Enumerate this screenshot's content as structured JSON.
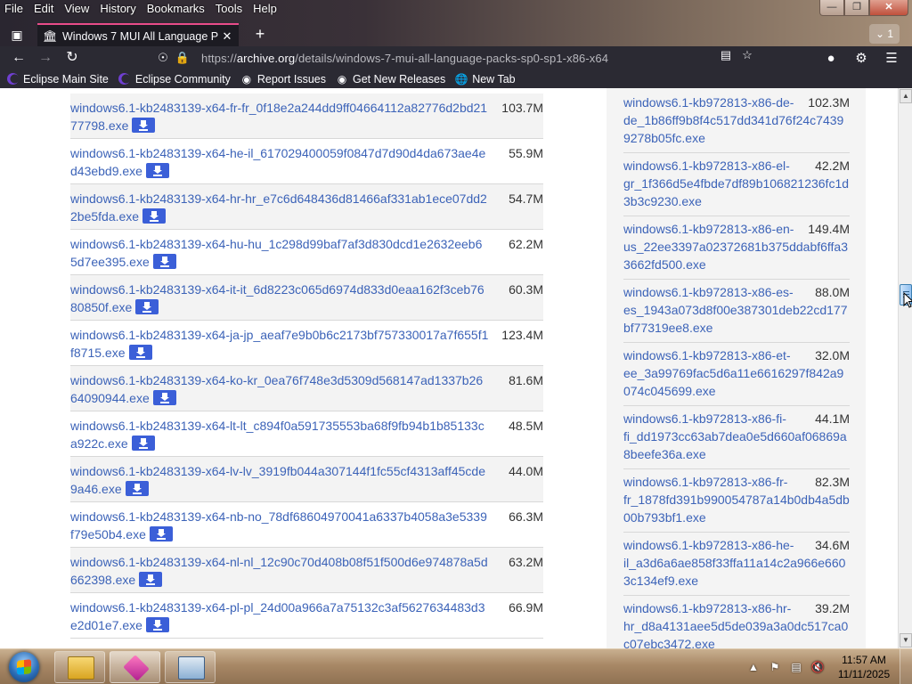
{
  "menubar": {
    "items": [
      "File",
      "Edit",
      "View",
      "History",
      "Bookmarks",
      "Tools",
      "Help"
    ]
  },
  "tabs": {
    "active_title": "Windows 7 MUI All Language P",
    "tab_count": "1"
  },
  "navbar": {
    "url_prefix": "https://",
    "url_host": "archive.org",
    "url_path": "/details/windows-7-mui-all-language-packs-sp0-sp1-x86-x64"
  },
  "bookmarks": [
    {
      "label": "Eclipse Main Site",
      "icon": "eclipse-icon"
    },
    {
      "label": "Eclipse Community",
      "icon": "eclipse-icon"
    },
    {
      "label": "Report Issues",
      "icon": "github-icon"
    },
    {
      "label": "Get New Releases",
      "icon": "github-icon"
    },
    {
      "label": "New Tab",
      "icon": "globe-icon"
    }
  ],
  "left_files": [
    {
      "name": "windows6.1-kb2483139-x64-fr-fr_0f18e2a244dd9ff04664112a82776d2bd2177798.exe",
      "size": "103.7M"
    },
    {
      "name": "windows6.1-kb2483139-x64-he-il_617029400059f0847d7d90d4da673ae4ed43ebd9.exe",
      "size": "55.9M"
    },
    {
      "name": "windows6.1-kb2483139-x64-hr-hr_e7c6d648436d81466af331ab1ece07dd22be5fda.exe",
      "size": "54.7M"
    },
    {
      "name": "windows6.1-kb2483139-x64-hu-hu_1c298d99baf7af3d830dcd1e2632eeb65d7ee395.exe",
      "size": "62.2M"
    },
    {
      "name": "windows6.1-kb2483139-x64-it-it_6d8223c065d6974d833d0eaa162f3ceb7680850f.exe",
      "size": "60.3M"
    },
    {
      "name": "windows6.1-kb2483139-x64-ja-jp_aeaf7e9b0b6c2173bf757330017a7f655f1f8715.exe",
      "size": "123.4M"
    },
    {
      "name": "windows6.1-kb2483139-x64-ko-kr_0ea76f748e3d5309d568147ad1337b2664090944.exe",
      "size": "81.6M"
    },
    {
      "name": "windows6.1-kb2483139-x64-lt-lt_c894f0a591735553ba68f9fb94b1b85133ca922c.exe",
      "size": "48.5M"
    },
    {
      "name": "windows6.1-kb2483139-x64-lv-lv_3919fb044a307144f1fc55cf4313aff45cde9a46.exe",
      "size": "44.0M"
    },
    {
      "name": "windows6.1-kb2483139-x64-nb-no_78df68604970041a6337b4058a3e5339f79e50b4.exe",
      "size": "66.3M"
    },
    {
      "name": "windows6.1-kb2483139-x64-nl-nl_12c90c70d408b08f51f500d6e974878a5d662398.exe",
      "size": "63.2M"
    },
    {
      "name": "windows6.1-kb2483139-x64-pl-pl_24d00a966a7a75132c3af5627634483d3e2d01e7.exe",
      "size": "66.9M"
    }
  ],
  "right_files": [
    {
      "first": "windows6.1-kb972813-x86-de-",
      "rest": "de_1b86ff9b8f4c517dd341d76f24c74399278b05fc.exe",
      "size": "102.3M"
    },
    {
      "first": "windows6.1-kb972813-x86-el-",
      "rest": "gr_1f366d5e4fbde7df89b106821236fc1d3b3c9230.exe",
      "size": "42.2M"
    },
    {
      "first": "windows6.1-kb972813-x86-en-",
      "rest": "us_22ee3397a02372681b375ddabf6ffa33662fd500.exe",
      "size": "149.4M"
    },
    {
      "first": "windows6.1-kb972813-x86-es-",
      "rest": "es_1943a073d8f00e387301deb22cd177bf77319ee8.exe",
      "size": "88.0M"
    },
    {
      "first": "windows6.1-kb972813-x86-et-",
      "rest": "ee_3a99769fac5d6a11e6616297f842a9074c045699.exe",
      "size": "32.0M"
    },
    {
      "first": "windows6.1-kb972813-x86-fi-",
      "rest": "fi_dd1973cc63ab7dea0e5d660af06869a8beefe36a.exe",
      "size": "44.1M"
    },
    {
      "first": "windows6.1-kb972813-x86-fr-",
      "rest": "fr_1878fd391b990054787a14b0db4a5db00b793bf1.exe",
      "size": "82.3M"
    },
    {
      "first": "windows6.1-kb972813-x86-he-",
      "rest": "il_a3d6a6ae858f33ffa11a14c2a966e6603c134ef9.exe",
      "size": "34.6M"
    },
    {
      "first": "windows6.1-kb972813-x86-hr-",
      "rest": "hr_d8a4131aee5d5de039a3a0dc517ca0c07ebc3472.exe",
      "size": "39.2M"
    }
  ],
  "taskbar": {
    "time": "11:57 AM",
    "date": "11/11/2025"
  }
}
